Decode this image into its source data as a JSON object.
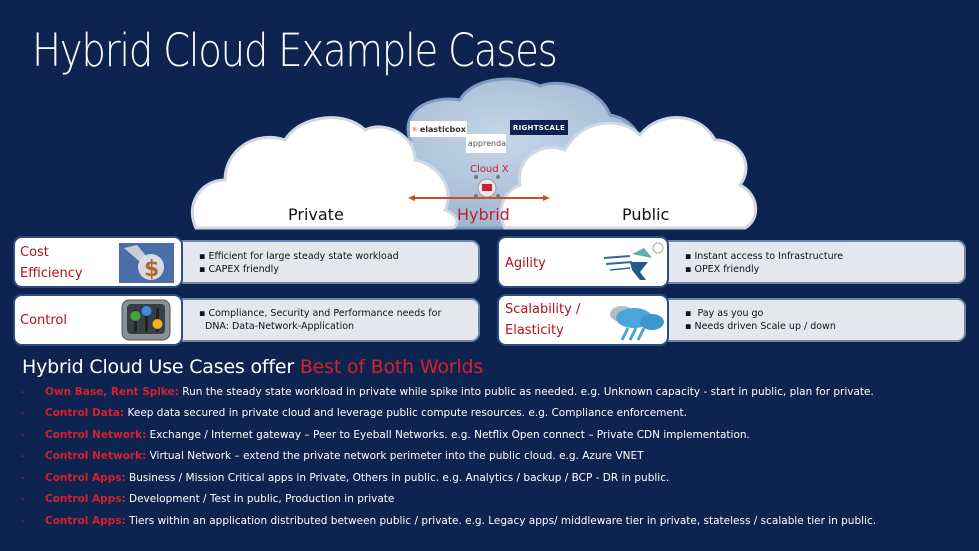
{
  "title": "Hybrid Cloud Example Cases",
  "diagram": {
    "private_label": "Private",
    "hybrid_label": "Hybrid",
    "public_label": "Public",
    "cloud_x_label": "Cloud X",
    "vendor_logos": [
      "elasticbox",
      "RIGHTSCALE",
      "apprenda"
    ],
    "accent_red": "#c81e2a",
    "arrow_color": "#c8501e"
  },
  "private_benefits": [
    {
      "label_line1": "Cost",
      "label_line2": "Efficiency",
      "icon": "dollar-wrench-icon",
      "bullets": [
        "Efficient for large steady state workload",
        "CAPEX friendly"
      ]
    },
    {
      "label_line1": "Control",
      "label_line2": "",
      "icon": "control-sliders-icon",
      "bullets": [
        "Compliance, Security and Performance needs for",
        "DNA: Data-Network-Application"
      ]
    }
  ],
  "public_benefits": [
    {
      "label_line1": "Agility",
      "label_line2": "",
      "icon": "runner-icon",
      "bullets": [
        "Instant access to Infrastructure",
        "OPEX friendly"
      ]
    },
    {
      "label_line1": "Scalability /",
      "label_line2": "Elasticity",
      "icon": "cloud-rain-icon",
      "bullets": [
        "Pay as you go",
        "Needs driven Scale up / down"
      ]
    }
  ],
  "subtitle": {
    "prefix": "Hybrid Cloud Use Cases offer ",
    "highlight": "Best of Both Worlds"
  },
  "use_cases": [
    {
      "key": "Own Base, Rent Spike:",
      "text": " Run the steady state workload in private while spike into public as needed. e.g. Unknown capacity - start in public, plan for private."
    },
    {
      "key": "Control Data:",
      "text": " Keep data secured in private cloud and leverage public compute resources. e.g. Compliance enforcement."
    },
    {
      "key": "Control Network:",
      "text": " Exchange / Internet gateway – Peer to Eyeball Networks. e.g. Netflix Open connect – Private CDN implementation."
    },
    {
      "key": "Control Network:",
      "text": " Virtual Network – extend the private network perimeter into the public cloud. e.g. Azure VNET"
    },
    {
      "key": "Control Apps:",
      "text": " Business / Mission Critical apps in Private, Others in public. e.g. Analytics / backup / BCP - DR in public."
    },
    {
      "key": "Control Apps:",
      "text": " Development / Test in public, Production in private"
    },
    {
      "key": "Control Apps:",
      "text": " Tiers within an application distributed between public / private. e.g. Legacy apps/ middleware tier in private, stateless / scalable tier in public."
    }
  ],
  "dash": "-"
}
